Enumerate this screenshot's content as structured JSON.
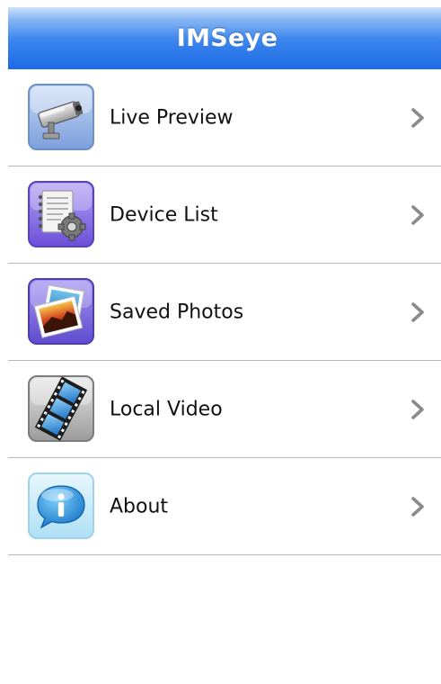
{
  "app": {
    "title": "IMSeye"
  },
  "menu": {
    "items": [
      {
        "label": "Live Preview",
        "icon": "security-camera-icon"
      },
      {
        "label": "Device List",
        "icon": "device-list-settings-icon"
      },
      {
        "label": "Saved Photos",
        "icon": "photos-icon"
      },
      {
        "label": "Local Video",
        "icon": "film-strip-icon"
      },
      {
        "label": "About",
        "icon": "info-bubble-icon"
      }
    ]
  },
  "colors": {
    "titlebar_top": "#cfe4fb",
    "titlebar_bottom": "#1c6be6",
    "divider": "#b9b9b9",
    "chevron": "#8a8a8a"
  }
}
